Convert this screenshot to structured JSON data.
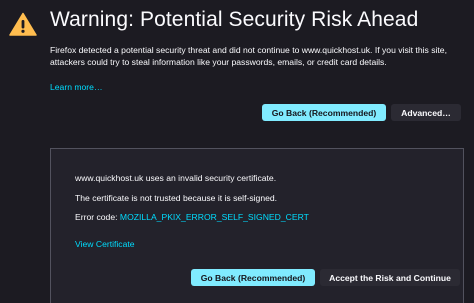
{
  "header": {
    "title": "Warning: Potential Security Risk Ahead",
    "icon": "warning-icon"
  },
  "description": "Firefox detected a potential security threat and did not continue to www.quickhost.uk. If you visit this site, attackers could try to steal information like your passwords, emails, or credit card details.",
  "learn_more": "Learn more…",
  "actions": {
    "go_back": "Go Back (Recommended)",
    "advanced": "Advanced…"
  },
  "advanced_panel": {
    "line1": "www.quickhost.uk uses an invalid security certificate.",
    "line2": "The certificate is not trusted because it is self-signed.",
    "error_label": "Error code: ",
    "error_code": "MOZILLA_PKIX_ERROR_SELF_SIGNED_CERT",
    "view_certificate": "View Certificate",
    "go_back": "Go Back (Recommended)",
    "accept": "Accept the Risk and Continue"
  },
  "colors": {
    "background": "#1c1b22",
    "accent": "#80ebff",
    "link": "#00ddff",
    "warning": "#ffbd4f"
  }
}
